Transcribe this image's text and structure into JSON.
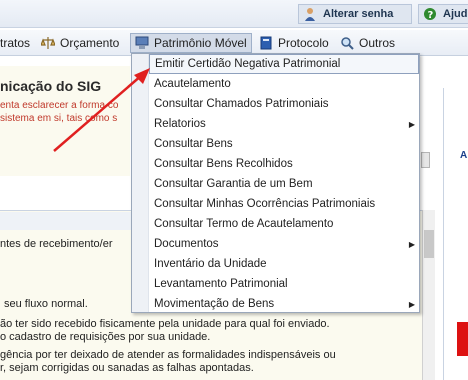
{
  "topbar": {
    "change_password_label": "Alterar senha",
    "help_label": "Ajud"
  },
  "menubar": {
    "items": [
      {
        "label": "tratos"
      },
      {
        "label": "Orçamento"
      },
      {
        "label": "Patrimônio Móvel"
      },
      {
        "label": "Protocolo"
      },
      {
        "label": "Outros"
      }
    ]
  },
  "background": {
    "title": "nicação do SIG",
    "line1": "enta esclarecer a forma co",
    "line2": "sistema em si, tais como s",
    "line3": "ntes de recebimento/er",
    "line4": "seu fluxo normal.",
    "line5": "ão ter sido recebido fisicamente pela unidade para qual foi enviado.",
    "line6": "o cadastro de requisições por sua unidade.",
    "line7": "gência por ter deixado de atender as formalidades indispensáveis ou",
    "line8": "r, sejam corrigidas ou sanadas as falhas apontadas.",
    "right_letter": "A"
  },
  "dropdown": {
    "items": [
      {
        "label": "Emitir Certidão Negativa Patrimonial",
        "submenu": false
      },
      {
        "label": "Acautelamento",
        "submenu": false
      },
      {
        "label": "Consultar Chamados Patrimoniais",
        "submenu": false
      },
      {
        "label": "Relatorios",
        "submenu": true
      },
      {
        "label": "Consultar Bens",
        "submenu": false
      },
      {
        "label": "Consultar Bens Recolhidos",
        "submenu": false
      },
      {
        "label": "Consultar Garantia de um Bem",
        "submenu": false
      },
      {
        "label": "Consultar Minhas Ocorrências Patrimoniais",
        "submenu": false
      },
      {
        "label": "Consultar Termo de Acautelamento",
        "submenu": false
      },
      {
        "label": "Documentos",
        "submenu": true
      },
      {
        "label": "Inventário da Unidade",
        "submenu": false
      },
      {
        "label": "Levantamento Patrimonial",
        "submenu": false
      },
      {
        "label": "Movimentação de Bens",
        "submenu": true
      }
    ],
    "submenu_glyph": "▶"
  },
  "colors": {
    "annotation_arrow": "#e02020",
    "menu_active_bg": "#d3dbe8"
  }
}
